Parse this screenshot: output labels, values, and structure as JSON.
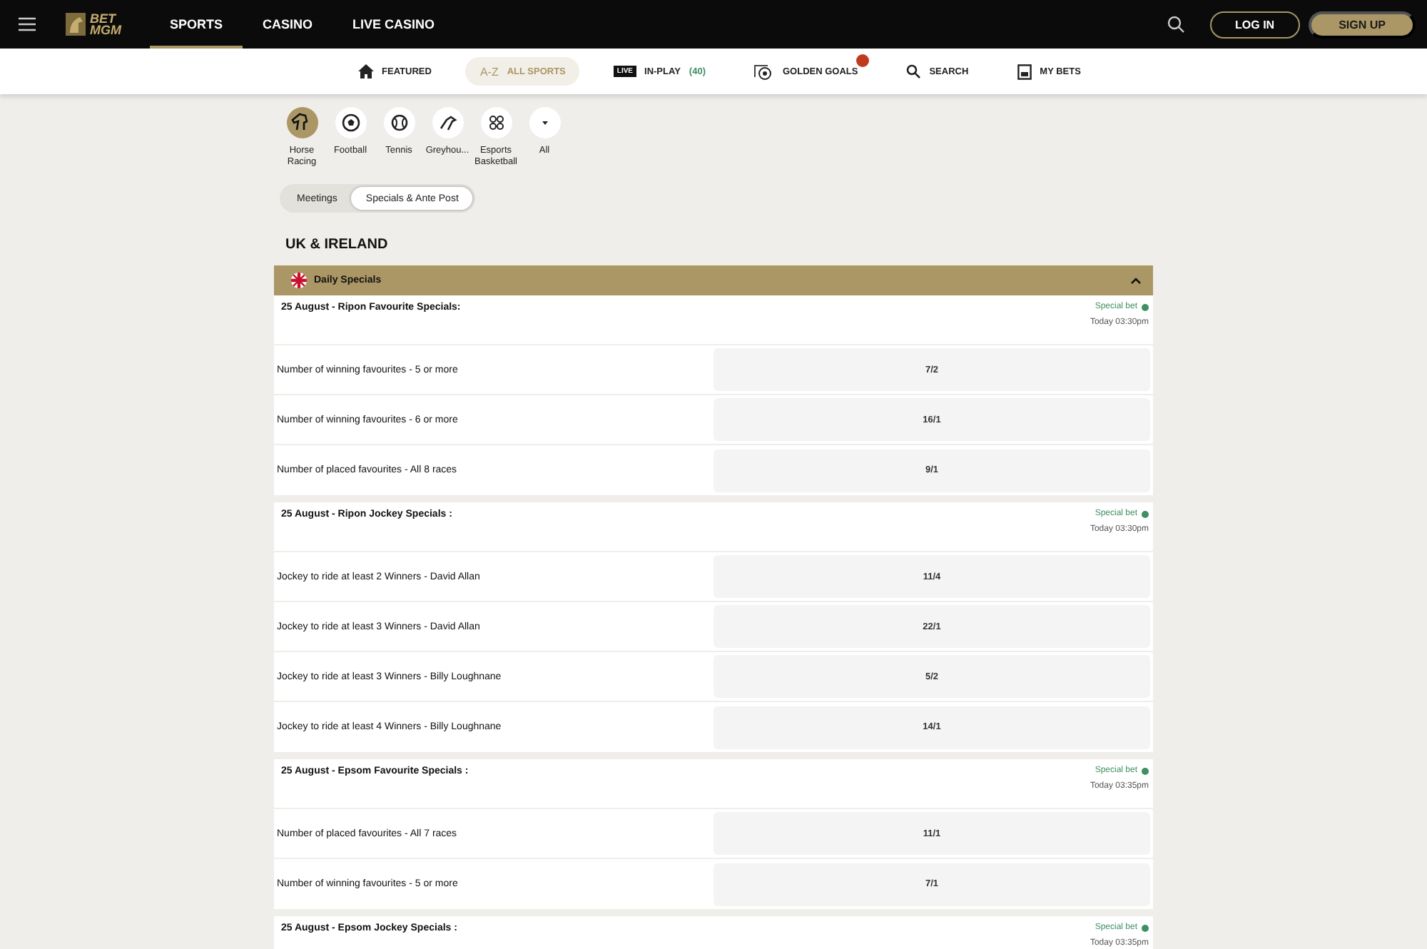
{
  "header": {
    "logo_top": "BET",
    "logo_bottom": "MGM",
    "nav": [
      {
        "label": "SPORTS",
        "selected": true
      },
      {
        "label": "CASINO",
        "selected": false
      },
      {
        "label": "LIVE CASINO",
        "selected": false
      }
    ],
    "login": "LOG IN",
    "signup": "SIGN UP"
  },
  "subnav": [
    {
      "kind": "featured",
      "label": "FEATURED",
      "selected": false
    },
    {
      "kind": "az",
      "icon_text": "A-Z",
      "label": "ALL SPORTS",
      "selected": true
    },
    {
      "kind": "live",
      "icon_text": "LIVE",
      "label": "IN-PLAY",
      "count": "(40)",
      "selected": false
    },
    {
      "kind": "goals",
      "label": "GOLDEN GOALS",
      "badge": true,
      "selected": false
    },
    {
      "kind": "search",
      "label": "SEARCH",
      "selected": false
    },
    {
      "kind": "bets",
      "label": "MY BETS",
      "selected": false
    }
  ],
  "sports": [
    {
      "kind": "horse",
      "label": "Horse Racing",
      "selected": true
    },
    {
      "kind": "football",
      "label": "Football",
      "selected": false
    },
    {
      "kind": "tennis",
      "label": "Tennis",
      "selected": false
    },
    {
      "kind": "greyhound",
      "label": "Greyhou...",
      "selected": false
    },
    {
      "kind": "esports",
      "label": "Esports Basketball",
      "selected": false
    },
    {
      "kind": "all",
      "label": "All",
      "selected": false
    }
  ],
  "tabs": [
    {
      "label": "Meetings",
      "selected": false
    },
    {
      "label": "Specials & Ante Post",
      "selected": true
    }
  ],
  "heading": "UK & IRELAND",
  "section": {
    "title": "Daily Specials",
    "expanded": true
  },
  "events": [
    {
      "title": "25 August - Ripon Favourite Specials:",
      "tag": "Special bet",
      "time": "Today 03:30pm",
      "bets": [
        {
          "label": "Number of winning favourites - 5 or more",
          "odds": "7/2"
        },
        {
          "label": "Number of winning favourites - 6 or more",
          "odds": "16/1"
        },
        {
          "label": "Number of placed favourites - All 8 races",
          "odds": "9/1"
        }
      ]
    },
    {
      "title": "25 August - Ripon Jockey Specials :",
      "tag": "Special bet",
      "time": "Today 03:30pm",
      "bets": [
        {
          "label": "Jockey to ride at least 2 Winners - David Allan",
          "odds": "11/4"
        },
        {
          "label": "Jockey to ride at least 3 Winners - David Allan",
          "odds": "22/1"
        },
        {
          "label": "Jockey to ride at least 3 Winners - Billy Loughnane",
          "odds": "5/2"
        },
        {
          "label": "Jockey to ride at least 4 Winners - Billy Loughnane",
          "odds": "14/1"
        }
      ]
    },
    {
      "title": "25 August - Epsom Favourite Specials :",
      "tag": "Special bet",
      "time": "Today 03:35pm",
      "bets": [
        {
          "label": "Number of placed favourites - All 7 races",
          "odds": "11/1"
        },
        {
          "label": "Number of winning favourites - 5 or more",
          "odds": "7/1"
        }
      ]
    },
    {
      "title": "25 August - Epsom Jockey Specials :",
      "tag": "Special bet",
      "time": "Today 03:35pm"
    }
  ]
}
